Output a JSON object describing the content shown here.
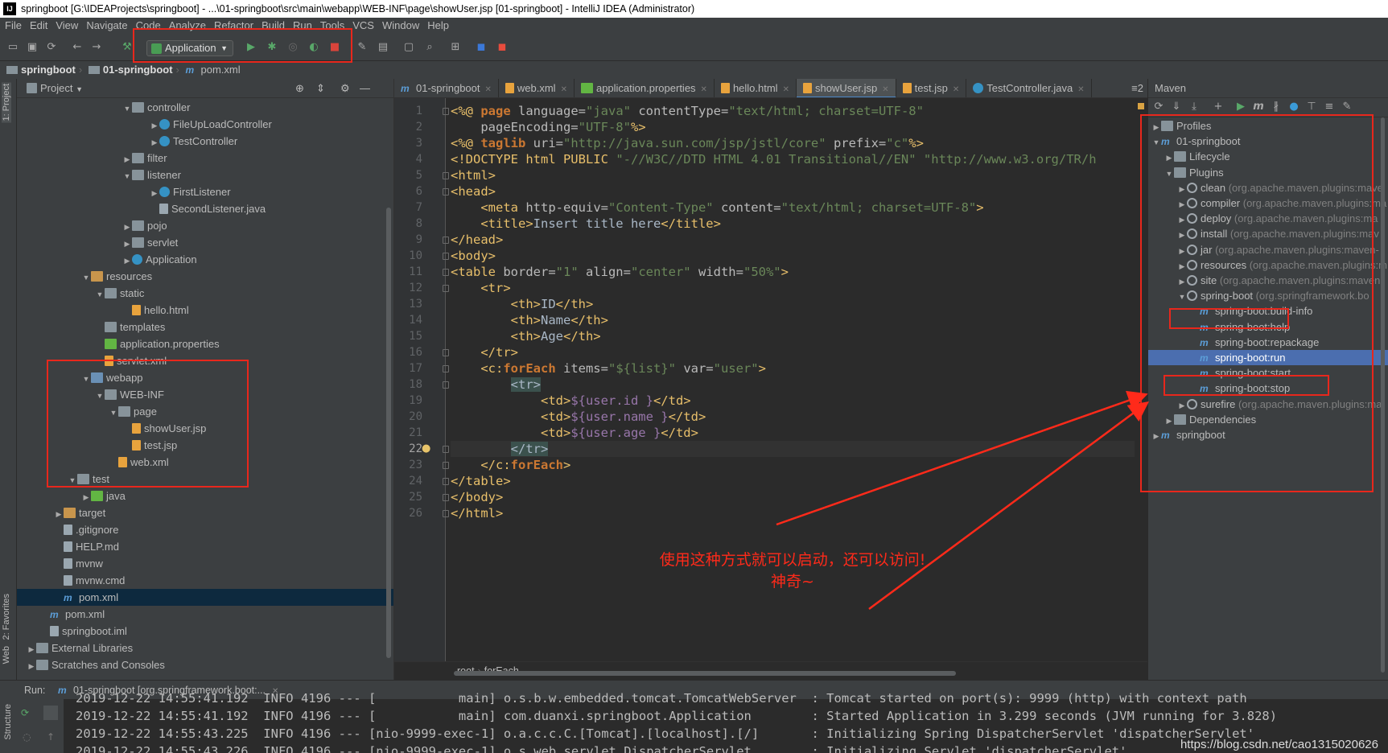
{
  "window": {
    "title": "springboot [G:\\IDEAProjects\\springboot] - ...\\01-springboot\\src\\main\\webapp\\WEB-INF\\page\\showUser.jsp [01-springboot] - IntelliJ IDEA (Administrator)",
    "logo_text": "IJ"
  },
  "menu": [
    "File",
    "Edit",
    "View",
    "Navigate",
    "Code",
    "Analyze",
    "Refactor",
    "Build",
    "Run",
    "Tools",
    "VCS",
    "Window",
    "Help"
  ],
  "toolbar": {
    "run_config": "Application",
    "icons": [
      "folder-icon",
      "save-icon",
      "sync-icon",
      "back-icon",
      "forward-icon",
      "build-icon",
      "run-icon",
      "debug-icon",
      "coverage-icon",
      "profile-icon",
      "stop-icon",
      "wrench-icon",
      "structure-icon",
      "frame-icon",
      "search-icon",
      "vcs-icon",
      "translate-icon",
      "plugin-icon"
    ]
  },
  "breadcrumb": [
    "springboot",
    "01-springboot",
    "pom.xml"
  ],
  "project": {
    "header": "Project",
    "side_label": "1: Project",
    "favorites_label": "2: Favorites",
    "web_label": "Web",
    "structure_label": "Structure",
    "tree": [
      {
        "label": "controller",
        "indent": 7,
        "arrow": "▼",
        "icon": "fold"
      },
      {
        "label": "FileUpLoadController",
        "indent": 9,
        "arrow": "▶",
        "icon": "cls"
      },
      {
        "label": "TestController",
        "indent": 9,
        "arrow": "▶",
        "icon": "cls"
      },
      {
        "label": "filter",
        "indent": 7,
        "arrow": "▶",
        "icon": "fold"
      },
      {
        "label": "listener",
        "indent": 7,
        "arrow": "▼",
        "icon": "fold"
      },
      {
        "label": "FirstListener",
        "indent": 9,
        "arrow": "▶",
        "icon": "cls"
      },
      {
        "label": "SecondListener.java",
        "indent": 9,
        "arrow": "",
        "icon": "file"
      },
      {
        "label": "pojo",
        "indent": 7,
        "arrow": "▶",
        "icon": "fold"
      },
      {
        "label": "servlet",
        "indent": 7,
        "arrow": "▶",
        "icon": "fold"
      },
      {
        "label": "Application",
        "indent": 7,
        "arrow": "▶",
        "icon": "cls"
      },
      {
        "label": "resources",
        "indent": 4,
        "arrow": "▼",
        "icon": "foldo"
      },
      {
        "label": "static",
        "indent": 5,
        "arrow": "▼",
        "icon": "fold"
      },
      {
        "label": "hello.html",
        "indent": 7,
        "arrow": "",
        "icon": "xml"
      },
      {
        "label": "templates",
        "indent": 5,
        "arrow": "",
        "icon": "fold"
      },
      {
        "label": "application.properties",
        "indent": 5,
        "arrow": "",
        "icon": "foldg"
      },
      {
        "label": "servlet.xml",
        "indent": 5,
        "arrow": "",
        "icon": "xml"
      },
      {
        "label": "webapp",
        "indent": 4,
        "arrow": "▼",
        "icon": "foldb"
      },
      {
        "label": "WEB-INF",
        "indent": 5,
        "arrow": "▼",
        "icon": "fold"
      },
      {
        "label": "page",
        "indent": 6,
        "arrow": "▼",
        "icon": "fold"
      },
      {
        "label": "showUser.jsp",
        "indent": 7,
        "arrow": "",
        "icon": "xml"
      },
      {
        "label": "test.jsp",
        "indent": 7,
        "arrow": "",
        "icon": "xml"
      },
      {
        "label": "web.xml",
        "indent": 6,
        "arrow": "",
        "icon": "xml"
      },
      {
        "label": "test",
        "indent": 3,
        "arrow": "▼",
        "icon": "fold"
      },
      {
        "label": "java",
        "indent": 4,
        "arrow": "▶",
        "icon": "foldg"
      },
      {
        "label": "target",
        "indent": 2,
        "arrow": "▶",
        "icon": "foldo"
      },
      {
        "label": ".gitignore",
        "indent": 2,
        "arrow": "",
        "icon": "file"
      },
      {
        "label": "HELP.md",
        "indent": 2,
        "arrow": "",
        "icon": "file"
      },
      {
        "label": "mvnw",
        "indent": 2,
        "arrow": "",
        "icon": "file"
      },
      {
        "label": "mvnw.cmd",
        "indent": 2,
        "arrow": "",
        "icon": "file"
      },
      {
        "label": "pom.xml",
        "indent": 2,
        "arrow": "",
        "icon": "m"
      },
      {
        "label": "pom.xml",
        "indent": 1,
        "arrow": "",
        "icon": "m"
      },
      {
        "label": "springboot.iml",
        "indent": 1,
        "arrow": "",
        "icon": "file"
      },
      {
        "label": "External Libraries",
        "indent": 0,
        "arrow": "▶",
        "icon": "fold"
      },
      {
        "label": "Scratches and Consoles",
        "indent": 0,
        "arrow": "▶",
        "icon": "fold"
      }
    ]
  },
  "editor": {
    "tabs": [
      {
        "label": "01-springboot",
        "icon": "m"
      },
      {
        "label": "web.xml",
        "icon": "xml"
      },
      {
        "label": "application.properties",
        "icon": "foldg"
      },
      {
        "label": "hello.html",
        "icon": "xml"
      },
      {
        "label": "showUser.jsp",
        "icon": "xml",
        "active": true
      },
      {
        "label": "test.jsp",
        "icon": "xml"
      },
      {
        "label": "TestController.java",
        "icon": "cls"
      }
    ],
    "tab_overflow": "≡2",
    "current_line": 22,
    "footer": [
      "root",
      "forEach"
    ],
    "lines": [
      [
        [
          "t",
          "<%@ "
        ],
        [
          "k",
          "page "
        ],
        [
          "a",
          "language="
        ],
        [
          "s",
          "\"java\" "
        ],
        [
          "a",
          "contentType="
        ],
        [
          "s",
          "\"text/html; charset=UTF-8\""
        ]
      ],
      [
        [
          "a",
          "    pageEncoding="
        ],
        [
          "s",
          "\"UTF-8\""
        ],
        [
          "t",
          "%>"
        ]
      ],
      [
        [
          "t",
          "<%@ "
        ],
        [
          "k",
          "taglib "
        ],
        [
          "a",
          "uri="
        ],
        [
          "s",
          "\"http://java.sun.com/jsp/jstl/core\" "
        ],
        [
          "a",
          "prefix="
        ],
        [
          "s",
          "\"c\""
        ],
        [
          "t",
          "%>"
        ]
      ],
      [
        [
          "t",
          "<!DOCTYPE html PUBLIC "
        ],
        [
          "s",
          "\"-//W3C//DTD HTML 4.01 Transitional//EN\" \"http://www.w3.org/TR/h"
        ]
      ],
      [
        [
          "t",
          "<html>"
        ]
      ],
      [
        [
          "t",
          "<head>"
        ]
      ],
      [
        [
          "t",
          "    <meta "
        ],
        [
          "a",
          "http-equiv="
        ],
        [
          "s",
          "\"Content-Type\" "
        ],
        [
          "a",
          "content="
        ],
        [
          "s",
          "\"text/html; charset=UTF-8\""
        ],
        [
          "t",
          ">"
        ]
      ],
      [
        [
          "t",
          "    <title>"
        ],
        [
          "tx",
          "Insert title here"
        ],
        [
          "t",
          "</title>"
        ]
      ],
      [
        [
          "t",
          "</head>"
        ]
      ],
      [
        [
          "t",
          "<body>"
        ]
      ],
      [
        [
          "t",
          "<table "
        ],
        [
          "a",
          "border="
        ],
        [
          "s",
          "\"1\" "
        ],
        [
          "a",
          "align="
        ],
        [
          "s",
          "\"center\" "
        ],
        [
          "a",
          "width="
        ],
        [
          "s",
          "\"50%\""
        ],
        [
          "t",
          ">"
        ]
      ],
      [
        [
          "t",
          "    <tr>"
        ]
      ],
      [
        [
          "t",
          "        <th>"
        ],
        [
          "tx",
          "ID"
        ],
        [
          "t",
          "</th>"
        ]
      ],
      [
        [
          "t",
          "        <th>"
        ],
        [
          "tx",
          "Name"
        ],
        [
          "t",
          "</th>"
        ]
      ],
      [
        [
          "t",
          "        <th>"
        ],
        [
          "tx",
          "Age"
        ],
        [
          "t",
          "</th>"
        ]
      ],
      [
        [
          "t",
          "    </tr>"
        ]
      ],
      [
        [
          "t",
          "    <c:"
        ],
        [
          "k",
          "forEach "
        ],
        [
          "a",
          "items="
        ],
        [
          "s",
          "\"${list}\" "
        ],
        [
          "a",
          "var="
        ],
        [
          "s",
          "\"user\""
        ],
        [
          "t",
          ">"
        ]
      ],
      [
        [
          "tx",
          "        "
        ],
        [
          "hl",
          "<tr>"
        ]
      ],
      [
        [
          "t",
          "            <td>"
        ],
        [
          "el",
          "${user.id }"
        ],
        [
          "t",
          "</td>"
        ]
      ],
      [
        [
          "t",
          "            <td>"
        ],
        [
          "el",
          "${user.name }"
        ],
        [
          "t",
          "</td>"
        ]
      ],
      [
        [
          "t",
          "            <td>"
        ],
        [
          "el",
          "${user.age }"
        ],
        [
          "t",
          "</td>"
        ]
      ],
      [
        [
          "tx",
          "        "
        ],
        [
          "hl",
          "</tr>"
        ]
      ],
      [
        [
          "t",
          "    </c:"
        ],
        [
          "k",
          "forEach"
        ],
        [
          "t",
          ">"
        ]
      ],
      [
        [
          "t",
          "</table>"
        ]
      ],
      [
        [
          "t",
          "</body>"
        ]
      ],
      [
        [
          "t",
          "</html>"
        ]
      ]
    ]
  },
  "maven": {
    "header": "Maven",
    "tree": [
      {
        "label": "Profiles",
        "indent": 0,
        "arrow": "▶",
        "icon": "fold",
        "grey": ""
      },
      {
        "label": "01-springboot",
        "indent": 0,
        "arrow": "▼",
        "icon": "m",
        "grey": ""
      },
      {
        "label": "Lifecycle",
        "indent": 1,
        "arrow": "▶",
        "icon": "fold",
        "grey": ""
      },
      {
        "label": "Plugins",
        "indent": 1,
        "arrow": "▼",
        "icon": "fold",
        "grey": ""
      },
      {
        "label": "clean",
        "indent": 2,
        "arrow": "▶",
        "icon": "gear",
        "grey": " (org.apache.maven.plugins:mave"
      },
      {
        "label": "compiler",
        "indent": 2,
        "arrow": "▶",
        "icon": "gear",
        "grey": " (org.apache.maven.plugins:ma"
      },
      {
        "label": "deploy",
        "indent": 2,
        "arrow": "▶",
        "icon": "gear",
        "grey": " (org.apache.maven.plugins:ma"
      },
      {
        "label": "install",
        "indent": 2,
        "arrow": "▶",
        "icon": "gear",
        "grey": " (org.apache.maven.plugins:mav"
      },
      {
        "label": "jar",
        "indent": 2,
        "arrow": "▶",
        "icon": "gear",
        "grey": " (org.apache.maven.plugins:maven-"
      },
      {
        "label": "resources",
        "indent": 2,
        "arrow": "▶",
        "icon": "gear",
        "grey": " (org.apache.maven.plugins:m"
      },
      {
        "label": "site",
        "indent": 2,
        "arrow": "▶",
        "icon": "gear",
        "grey": " (org.apache.maven.plugins:maven"
      },
      {
        "label": "spring-boot",
        "indent": 2,
        "arrow": "▼",
        "icon": "gear",
        "grey": " (org.springframework.bo"
      },
      {
        "label": "spring-boot:build-info",
        "indent": 3,
        "arrow": "",
        "icon": "m",
        "grey": ""
      },
      {
        "label": "spring-boot:help",
        "indent": 3,
        "arrow": "",
        "icon": "m",
        "grey": ""
      },
      {
        "label": "spring-boot:repackage",
        "indent": 3,
        "arrow": "",
        "icon": "m",
        "grey": ""
      },
      {
        "label": "spring-boot:run",
        "indent": 3,
        "arrow": "",
        "icon": "m",
        "grey": "",
        "selected": true
      },
      {
        "label": "spring-boot:start",
        "indent": 3,
        "arrow": "",
        "icon": "m",
        "grey": ""
      },
      {
        "label": "spring-boot:stop",
        "indent": 3,
        "arrow": "",
        "icon": "m",
        "grey": ""
      },
      {
        "label": "surefire",
        "indent": 2,
        "arrow": "▶",
        "icon": "gear",
        "grey": " (org.apache.maven.plugins:ma"
      },
      {
        "label": "Dependencies",
        "indent": 1,
        "arrow": "▶",
        "icon": "fold",
        "grey": ""
      },
      {
        "label": "springboot",
        "indent": 0,
        "arrow": "▶",
        "icon": "m",
        "grey": ""
      }
    ]
  },
  "run": {
    "label": "Run:",
    "config_tab": "01-springboot [org.springframework.boot:...",
    "lines": [
      "2019-12-22 14:55:41.192  INFO 4196 --- [           main] o.s.b.w.embedded.tomcat.TomcatWebServer  : Tomcat started on port(s): 9999 (http) with context path",
      "2019-12-22 14:55:41.192  INFO 4196 --- [           main] com.duanxi.springboot.Application        : Started Application in 3.299 seconds (JVM running for 3.828)",
      "2019-12-22 14:55:43.225  INFO 4196 --- [nio-9999-exec-1] o.a.c.c.C.[Tomcat].[localhost].[/]       : Initializing Spring DispatcherServlet 'dispatcherServlet'",
      "2019-12-22 14:55:43.226  INFO 4196 --- [nio-9999-exec-1] o.s.web.servlet.DispatcherServlet        : Initializing Servlet 'dispatcherServlet'"
    ]
  },
  "annotation": {
    "line1": "使用这种方式就可以启动，还可以访问!",
    "line2": "神奇~",
    "color": "#ff2a1a"
  },
  "watermark": "https://blog.csdn.net/cao1315020626"
}
